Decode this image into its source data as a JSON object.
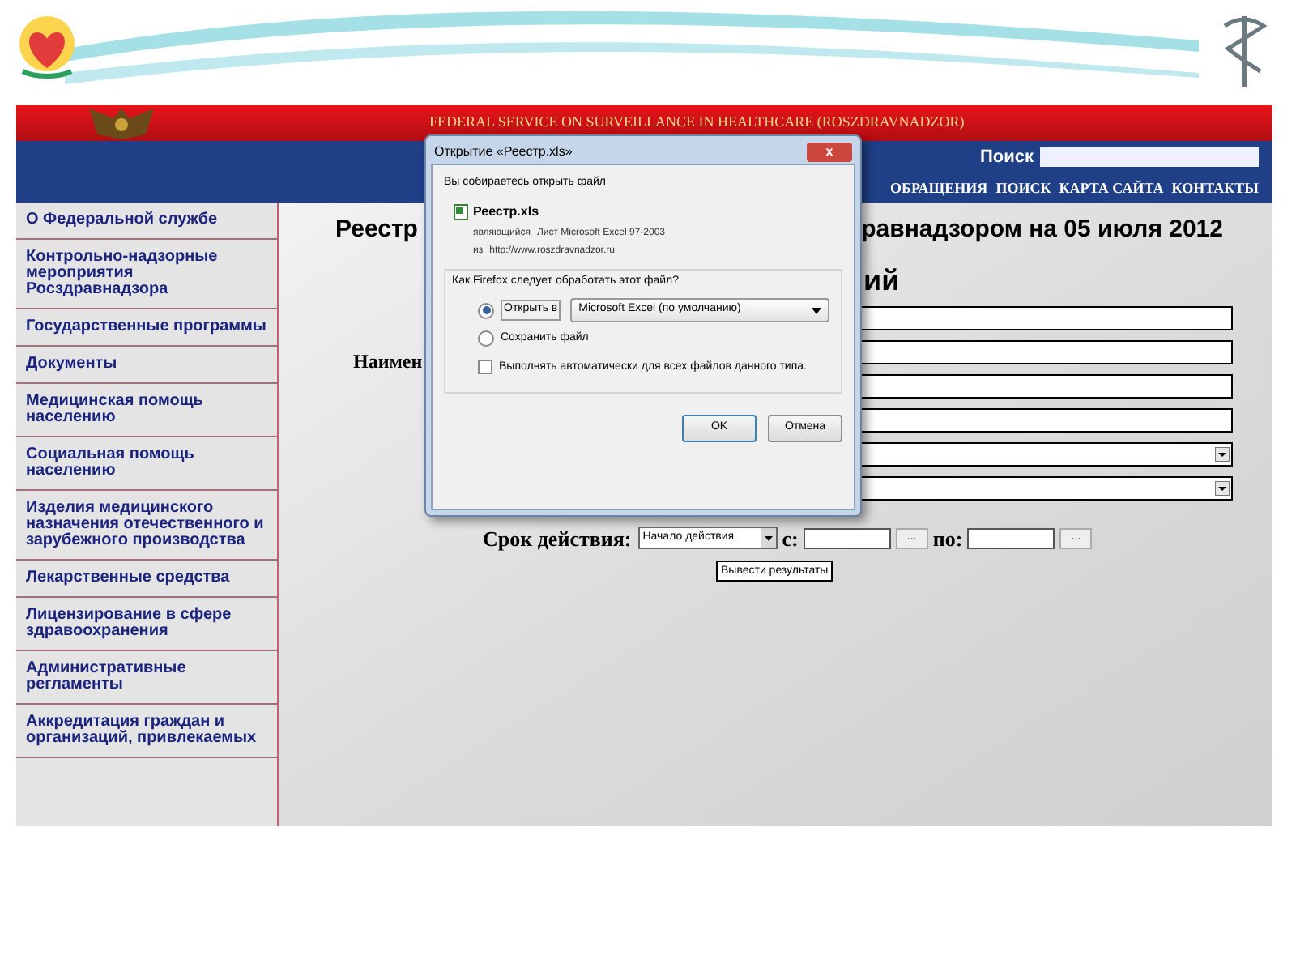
{
  "header": {
    "title": "FEDERAL SERVICE ON SURVEILLANCE IN HEALTHCARE (ROSZDRAVNADZOR)",
    "search_label": "Поиск",
    "nav": [
      "ОБРАЩЕНИЯ",
      "ПОИСК",
      "КАРТА САЙТА",
      "КОНТАКТЫ"
    ]
  },
  "sidebar": {
    "items": [
      "О Федеральной службе",
      "Контрольно-надзорные мероприятия Росздравнадзора",
      "Государственные программы",
      "Документы",
      "Медицинская помощь населению",
      "Социальная помощь населению",
      "Изделия медицинского назначения отечественного и зарубежного производства",
      "Лекарственные средства",
      "Лицензирование в сфере здравоохранения",
      "Административные регламенты",
      "Аккредитация граждан и организаций, привлекаемых"
    ]
  },
  "content": {
    "title_left": "Реестр",
    "title_right": "равнадзором на 05 июля 2012",
    "subtitle": "ий",
    "field_label": "Наимен",
    "fields": [
      {
        "kind": "input"
      },
      {
        "kind": "input"
      },
      {
        "kind": "input"
      },
      {
        "kind": "input"
      },
      {
        "kind": "select"
      },
      {
        "kind": "select"
      }
    ],
    "period": {
      "label": "Срок действия:",
      "select": "Начало действия",
      "from": "с:",
      "from_button": "...",
      "to": "по:",
      "to_button": "..."
    },
    "submit": "Вывести результаты"
  },
  "dialog": {
    "title": "Открытие «Реестр.xls»",
    "close": "x",
    "intro": "Вы собираетесь открыть файл",
    "file": "Реестр.xls",
    "type_label": "являющийся",
    "type": "Лист Microsoft Excel 97-2003",
    "from_label": "из",
    "from": "http://www.roszdravnadzor.ru",
    "question": "Как Firefox следует обработать этот файл?",
    "options": [
      {
        "label": "Открыть в",
        "selected": true,
        "app": "Microsoft Excel (по умолчанию)"
      },
      {
        "label": "Сохранить файл",
        "selected": false
      }
    ],
    "auto": {
      "label": "Выполнять автоматически для всех файлов данного типа.",
      "checked": false
    },
    "buttons": [
      "OK",
      "Отмена"
    ]
  }
}
